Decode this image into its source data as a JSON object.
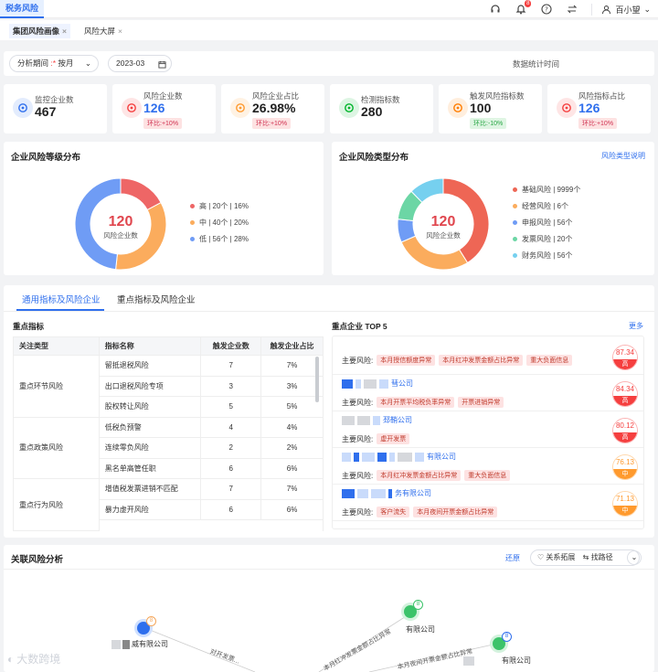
{
  "app": {
    "brand": "税务风险",
    "user": "百小望",
    "notif_count": "8"
  },
  "page_tabs": [
    {
      "label": "集团风险画像",
      "active": true
    },
    {
      "label": "风险大屏",
      "active": false
    }
  ],
  "filter": {
    "period_label": "分析期间",
    "period_value": "按月",
    "date_value": "2023-03",
    "stat_time_label": "数据统计时间"
  },
  "kpis": [
    {
      "label": "监控企业数",
      "value": "467",
      "icon": "target-icon",
      "color": "#2f6fed",
      "change": ""
    },
    {
      "label": "风险企业数",
      "value": "126",
      "icon": "building-icon",
      "color": "#f53f3f",
      "change": "环比:+10%",
      "change_type": "red",
      "blue": true
    },
    {
      "label": "风险企业占比",
      "value": "26.98%",
      "icon": "pie-icon",
      "color": "#ff9a2e",
      "change": "环比:+10%",
      "change_type": "red"
    },
    {
      "label": "检测指标数",
      "value": "280",
      "icon": "flask-icon",
      "color": "#00b42a",
      "change": ""
    },
    {
      "label": "触发风险指标数",
      "value": "100",
      "icon": "alert-icon",
      "color": "#ff7d00",
      "change": "环比:-10%",
      "change_type": "green"
    },
    {
      "label": "风险指标占比",
      "value": "126",
      "icon": "gauge-icon",
      "color": "#f53f3f",
      "change": "环比:+10%",
      "change_type": "red",
      "blue": true
    }
  ],
  "level_dist": {
    "title": "企业风险等级分布",
    "center_value": "120",
    "center_label": "风险企业数",
    "items": [
      {
        "label": "高 | 20个 | 16%",
        "value": 20,
        "color": "#ee6666"
      },
      {
        "label": "中 | 40个 | 20%",
        "value": 40,
        "color": "#fbac5d"
      },
      {
        "label": "低 | 56个 | 28%",
        "value": 56,
        "color": "#6f9cf5"
      }
    ]
  },
  "type_dist": {
    "title": "企业风险类型分布",
    "link": "风险类型说明",
    "center_value": "120",
    "center_label": "风险企业数",
    "items": [
      {
        "label": "基础风险 | 9999个",
        "value": 60,
        "color": "#ee6655"
      },
      {
        "label": "经营风险 | 6个",
        "value": 40,
        "color": "#fbac5d"
      },
      {
        "label": "申报风险 | 56个",
        "value": 12,
        "color": "#6f9cf5"
      },
      {
        "label": "发票风险 | 20个",
        "value": 16,
        "color": "#6cd6a5"
      },
      {
        "label": "财务风险 | 56个",
        "value": 18,
        "color": "#76d0ef"
      }
    ]
  },
  "section_tabs": [
    {
      "label": "通用指标及风险企业",
      "active": true
    },
    {
      "label": "重点指标及风险企业",
      "active": false
    }
  ],
  "key_indicators": {
    "title": "重点指标",
    "headers": [
      "关注类型",
      "指标名称",
      "触发企业数",
      "触发企业占比"
    ],
    "groups": [
      {
        "type": "重点环节风险",
        "rows": [
          [
            "留抵退税风险",
            "7",
            "7%"
          ],
          [
            "出口退税风险专项",
            "3",
            "3%"
          ],
          [
            "股权转让风险",
            "5",
            "5%"
          ]
        ]
      },
      {
        "type": "重点政策风险",
        "rows": [
          [
            "低税负预警",
            "4",
            "4%"
          ],
          [
            "连续零负风险",
            "2",
            "2%"
          ],
          [
            "黑名单高管任职",
            "6",
            "6%"
          ]
        ]
      },
      {
        "type": "重点行为风险",
        "rows": [
          [
            "增值税发票进销不匹配",
            "7",
            "7%"
          ],
          [
            "暴力虚开风险",
            "6",
            "6%"
          ]
        ]
      }
    ]
  },
  "top5": {
    "title": "重点企业 TOP 5",
    "more": "更多",
    "risk_label": "主要风险:",
    "items": [
      {
        "name": "",
        "tags": [
          "本月授信额度异常",
          "本月红冲发票金额占比异常",
          "重大负面信息"
        ],
        "score": "87.34",
        "level": "高",
        "level_color": "#f53f3f"
      },
      {
        "name": "彗公司",
        "tags": [
          "本月开票平均税负率异常",
          "开票进销异常"
        ],
        "score": "84.34",
        "level": "高",
        "level_color": "#f53f3f"
      },
      {
        "name": "邳鞘公司",
        "tags": [
          "虚开发票"
        ],
        "score": "80.12",
        "level": "高",
        "level_color": "#f53f3f"
      },
      {
        "name": "有限公司",
        "tags": [
          "本月红冲发票金额占比异常",
          "重大负面信息"
        ],
        "score": "76.13",
        "level": "中",
        "level_color": "#ff9a2e"
      },
      {
        "name": "务有限公司",
        "tags": [
          "客户流失",
          "本月夜间开票金额占比异常"
        ],
        "score": "71.13",
        "level": "中",
        "level_color": "#ff9a2e"
      }
    ]
  },
  "graph": {
    "title": "关联风险分析",
    "restore": "还原",
    "expand": "关系拓展",
    "find_path": "找路径",
    "nodes": [
      {
        "label": "威有限公司",
        "badge": "8"
      },
      {
        "label": "有限公司",
        "badge": "8"
      },
      {
        "label": "有限公司",
        "badge": "8"
      }
    ],
    "edges": [
      "对开发票...",
      "本月红冲发票金额占比异常",
      "本月夜间开票金额占比异常"
    ]
  },
  "watermark": "大数跨境"
}
